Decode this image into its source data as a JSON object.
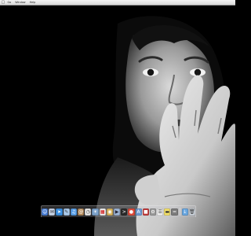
{
  "menubar": {
    "apple_icon": "apple-icon",
    "items": [
      {
        "label": "Go"
      },
      {
        "label": "Window"
      },
      {
        "label": "Help"
      }
    ]
  },
  "wallpaper": {
    "description_icon": "wallpaper-image"
  },
  "dock": {
    "items": [
      {
        "name": "finder-icon",
        "color": "#4a7fd6"
      },
      {
        "name": "mail-icon",
        "color": "#c7d3e6"
      },
      {
        "name": "safari-icon",
        "color": "#3b8fe0"
      },
      {
        "name": "ichat-icon",
        "color": "#a9c9ea"
      },
      {
        "name": "itunes-icon",
        "color": "#5aa0e8"
      },
      {
        "name": "address-book-icon",
        "color": "#b48a5a"
      },
      {
        "name": "clock-icon",
        "color": "#e9e9e9"
      },
      {
        "name": "iphoto-icon",
        "color": "#7aa0c8"
      },
      {
        "name": "ical-icon",
        "color": "#f2f2f2"
      },
      {
        "name": "preview-icon",
        "color": "#d9b35a"
      },
      {
        "name": "quicktime-icon",
        "color": "#9db5d6"
      },
      {
        "name": "terminal-icon",
        "color": "#2b2b2b"
      },
      {
        "name": "dvd-player-icon",
        "color": "#e04b3b"
      },
      {
        "name": "app-store-icon",
        "color": "#6f9bd2"
      },
      {
        "name": "photo-booth-icon",
        "color": "#c23b3b"
      },
      {
        "name": "system-preferences-icon",
        "color": "#9a9a9a"
      },
      {
        "name": "textedit-icon",
        "color": "#f0f0f0"
      },
      {
        "name": "stickies-icon",
        "color": "#f3e06a"
      },
      {
        "name": "calculator-icon",
        "color": "#7d7d7d"
      },
      {
        "name": "downloads-icon",
        "color": "#6aa7e0"
      },
      {
        "name": "trash-icon",
        "color": "#cfd6de"
      }
    ]
  }
}
